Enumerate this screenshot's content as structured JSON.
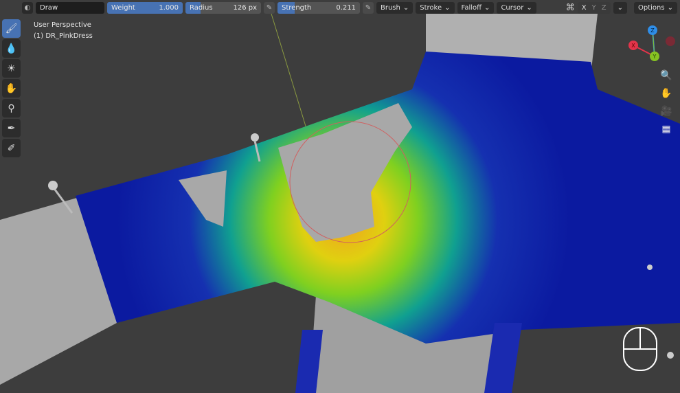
{
  "header": {
    "mode_icon": "sculpt-mode-icon",
    "brush_name": "Draw",
    "weight": {
      "label": "Weight",
      "value": "1.000",
      "fraction": 1.0
    },
    "radius": {
      "label": "Radius",
      "value": "126 px",
      "fraction": 0.2
    },
    "strength": {
      "label": "Strength",
      "value": "0.211",
      "fraction": 0.211
    },
    "menus": [
      "Brush",
      "Stroke",
      "Falloff",
      "Cursor"
    ],
    "mirror_axes": [
      "X",
      "Y",
      "Z"
    ],
    "options": "Options"
  },
  "overlay": {
    "view": "User Perspective",
    "object": "(1) DR_PinkDress"
  },
  "tools": [
    "draw-tool-icon",
    "blur-tool-icon",
    "average-tool-icon",
    "smear-tool-icon",
    "sample-tool-icon",
    "eyedropper-tool-icon",
    "annotate-tool-icon"
  ],
  "gizmo": {
    "z": "Z",
    "x": "X",
    "y": "Y",
    "colors": {
      "x": "#e2344a",
      "y": "#86c322",
      "z": "#2f8ee8"
    }
  },
  "accent": "#4772b3"
}
